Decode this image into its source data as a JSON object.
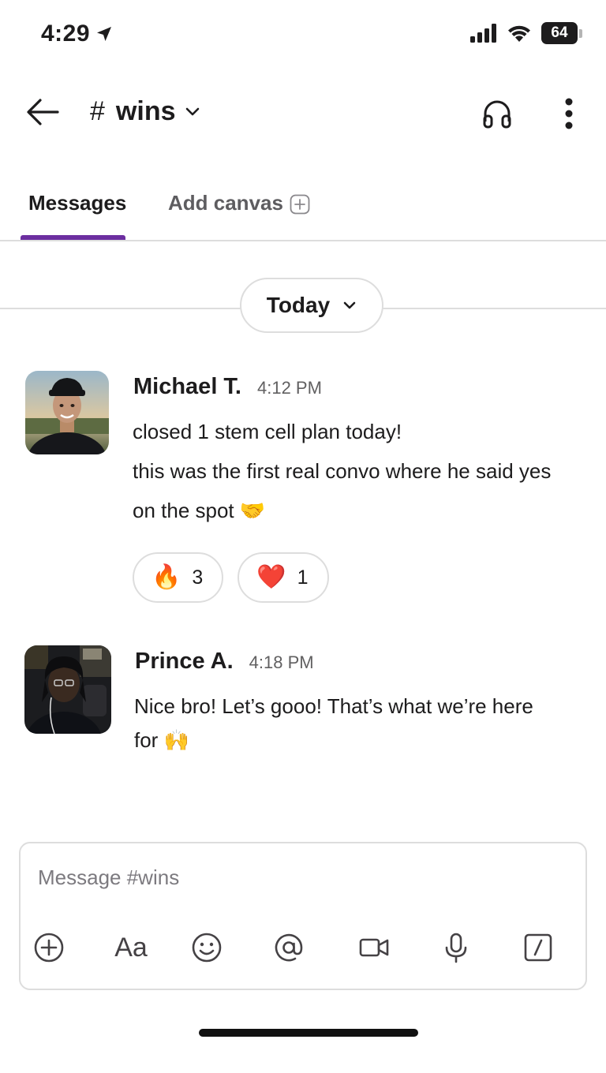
{
  "status_bar": {
    "time": "4:29",
    "battery": "64"
  },
  "header": {
    "channel_hash": "#",
    "channel_name": "wins"
  },
  "tabs": [
    {
      "label": "Messages",
      "active": true
    },
    {
      "label": "Add canvas",
      "active": false
    }
  ],
  "date_divider": {
    "label": "Today"
  },
  "messages": [
    {
      "author": "Michael T.",
      "time": "4:12 PM",
      "lines": [
        "closed 1 stem cell plan today!",
        "this was the first real convo where he said yes",
        "on the spot 🤝"
      ],
      "reactions": [
        {
          "emoji": "🔥",
          "count": "3"
        },
        {
          "emoji": "❤️",
          "count": "1"
        }
      ]
    },
    {
      "author": "Prince A.",
      "time": "4:18 PM",
      "lines": [
        "Nice bro! Let’s gooo! That’s what we’re here",
        "for 🙌"
      ]
    }
  ],
  "composer": {
    "placeholder": "Message #wins",
    "tools": [
      "plus-circle-icon",
      "text-format-icon",
      "emoji-icon",
      "mention-icon",
      "video-icon",
      "microphone-icon",
      "slash-command-icon"
    ],
    "format_label": "Aa"
  },
  "colors": {
    "accent": "#6c2ea0",
    "border": "#dddddd",
    "text": "#1d1c1d",
    "muted": "#616061"
  }
}
